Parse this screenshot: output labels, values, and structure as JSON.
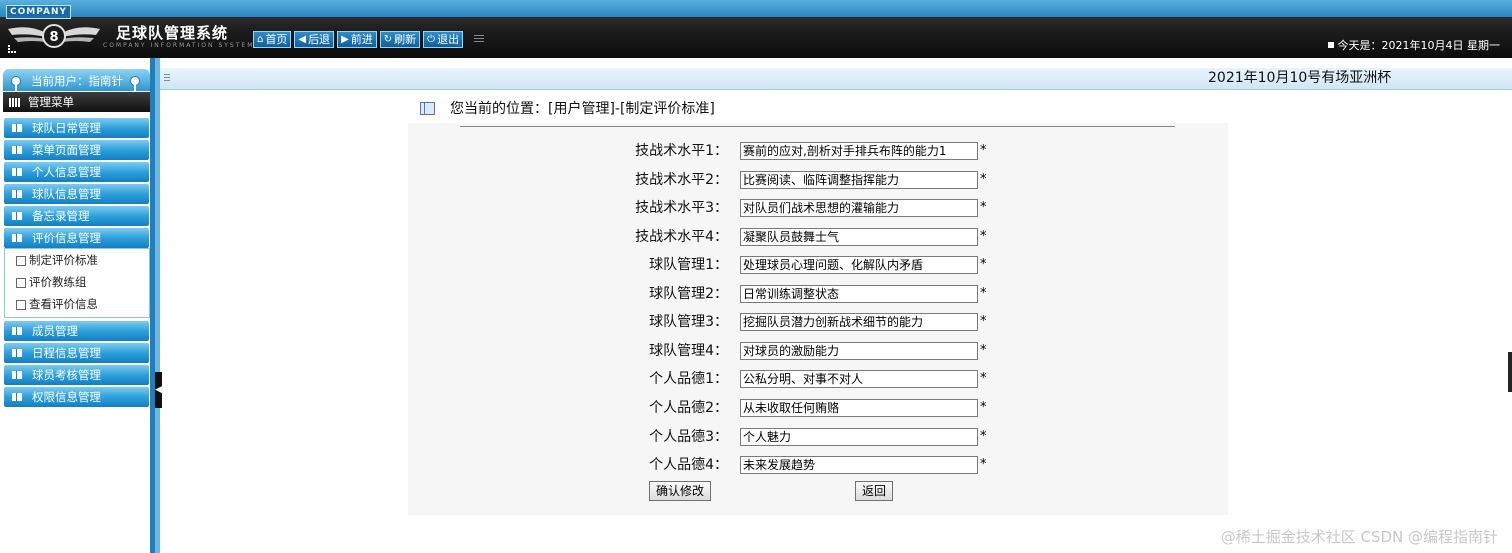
{
  "header": {
    "company_tag": "COMPANY",
    "title": "足球队管理系统",
    "subtitle": "COMPANY INFORMATION SYSTEM",
    "toolbar": [
      {
        "label": "首页",
        "icon": "home-icon",
        "glyph": "⌂"
      },
      {
        "label": "后退",
        "icon": "back-arrow-icon",
        "glyph": "◀"
      },
      {
        "label": "前进",
        "icon": "forward-arrow-icon",
        "glyph": "▶"
      },
      {
        "label": "刷新",
        "icon": "refresh-icon",
        "glyph": "↻"
      },
      {
        "label": "退出",
        "icon": "power-icon",
        "glyph": "⏻"
      }
    ],
    "today": "今天是：2021年10月4日 星期一"
  },
  "sidebar": {
    "current_user": "当前用户：指南针",
    "menu_title": "管理菜单",
    "items_top": [
      {
        "label": "球队日常管理"
      },
      {
        "label": "菜单页面管理"
      },
      {
        "label": "个人信息管理"
      },
      {
        "label": "球队信息管理"
      },
      {
        "label": "备忘录管理"
      },
      {
        "label": "评价信息管理"
      }
    ],
    "submenu": [
      {
        "label": "制定评价标准"
      },
      {
        "label": "评价教练组"
      },
      {
        "label": "查看评价信息"
      }
    ],
    "items_bottom": [
      {
        "label": "成员管理"
      },
      {
        "label": "日程信息管理"
      },
      {
        "label": "球员考核管理"
      },
      {
        "label": "权限信息管理"
      }
    ]
  },
  "content": {
    "announcement": "2021年10月10号有场亚洲杯",
    "position": "您当前的位置：[用户管理]-[制定评价标准]",
    "fields": [
      {
        "label": "技战术水平1：",
        "value": "赛前的应对,剖析对手排兵布阵的能力1"
      },
      {
        "label": "技战术水平2：",
        "value": "比赛阅读、临阵调整指挥能力"
      },
      {
        "label": "技战术水平3：",
        "value": "对队员们战术思想的灌输能力"
      },
      {
        "label": "技战术水平4：",
        "value": "凝聚队员鼓舞士气"
      },
      {
        "label": "球队管理1：",
        "value": "处理球员心理问题、化解队内矛盾"
      },
      {
        "label": "球队管理2：",
        "value": "日常训练调整状态"
      },
      {
        "label": "球队管理3：",
        "value": "挖掘队员潜力创新战术细节的能力"
      },
      {
        "label": "球队管理4：",
        "value": "对球员的激励能力"
      },
      {
        "label": "个人品德1：",
        "value": "公私分明、对事不对人"
      },
      {
        "label": "个人品德2：",
        "value": "从未收取任何贿赂"
      },
      {
        "label": "个人品德3：",
        "value": "个人魅力"
      },
      {
        "label": "个人品德4：",
        "value": "未来发展趋势"
      }
    ],
    "required_mark": "*",
    "confirm_label": "确认修改",
    "back_label": "返回"
  },
  "watermark": "@稀土掘金技术社区 CSDN @编程指南针"
}
